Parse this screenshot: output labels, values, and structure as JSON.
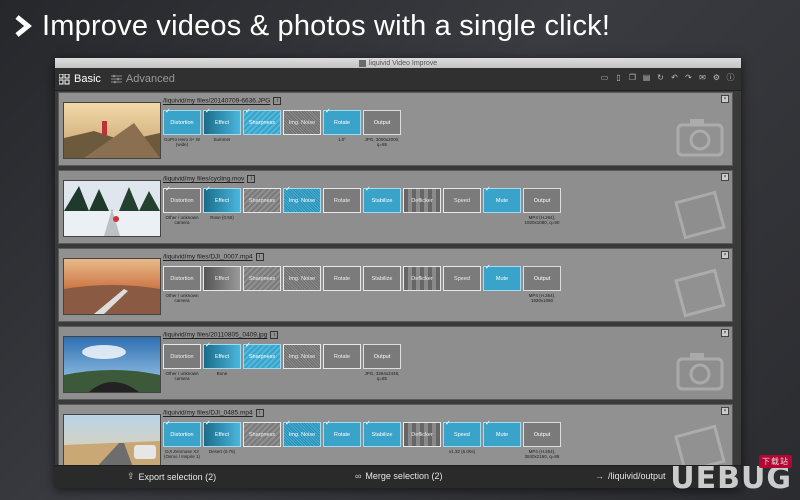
{
  "headline": "Improve videos & photos with a single click!",
  "window": {
    "title": "liquivid Video Improve"
  },
  "tabs": {
    "basic": "Basic",
    "advanced": "Advanced"
  },
  "step_labels": {
    "distortion": "Distortion",
    "effect": "Effect",
    "sharpness": "Sharpness",
    "noise": "Img. Noise",
    "rotate": "Rotate",
    "stabilize": "Stabilize",
    "deflicker": "Deflicker",
    "speed": "Speed",
    "mute": "Mute",
    "output": "Output"
  },
  "rows": [
    {
      "file": "/liquivid/my files/20140709-6636.JPG",
      "subs": {
        "distortion": "GoPro Hero 3+ W (wide)",
        "effect": "Summer",
        "rotate": "1.0°",
        "output": "JPG, 3000x2000, q=85"
      }
    },
    {
      "file": "/liquivid/my files/cycling.mov",
      "subs": {
        "distortion": "Other / unknown camera",
        "effect": "Rose (0.50)",
        "output": "MP4 (H.264), 1920x1080, q=90"
      }
    },
    {
      "file": "/liquivid/my files/DJI_0007.mp4",
      "subs": {
        "distortion": "Other / unknown camera",
        "output": "MP4 (H.264), 1920x1080"
      }
    },
    {
      "file": "/liquivid/my files/20110805_0409.jpg",
      "subs": {
        "distortion": "Other / unknown camera",
        "effect": "Bone",
        "output": "JPG, 3264x2448, q=85"
      }
    },
    {
      "file": "/liquivid/my files/DJI_0485.mp4",
      "subs": {
        "distortion": "DJI Zenmuse X3 (Osmo / Inspire 1)",
        "effect": "Desert (0.75)",
        "speed": "x1.32 (6.00s)",
        "output": "MP4 (H.264), 3840x2160, q=85"
      }
    }
  ],
  "footer": {
    "export": "Export selection (2)",
    "merge": "Merge selection (2)",
    "output": "/liquivid/output"
  },
  "watermark": {
    "text": "UEBUG",
    "badge": "下载站"
  }
}
